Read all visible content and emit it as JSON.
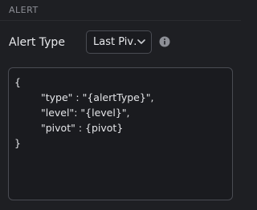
{
  "section": {
    "title": "ALERT"
  },
  "alert_type": {
    "label": "Alert Type",
    "selected": "Last Piv…",
    "chevron_icon": "chevron-down-icon",
    "info_icon": "info-circle-icon"
  },
  "editor": {
    "lines": [
      "{",
      "\"type\" : \"{alertType}\",",
      "\"level\": \"{level}\",",
      "\"pivot\" : {pivot}",
      "}"
    ]
  },
  "colors": {
    "background": "#1e1f23",
    "border": "#4a4c53",
    "text": "#e4e5e8",
    "muted": "#8d8f96"
  }
}
